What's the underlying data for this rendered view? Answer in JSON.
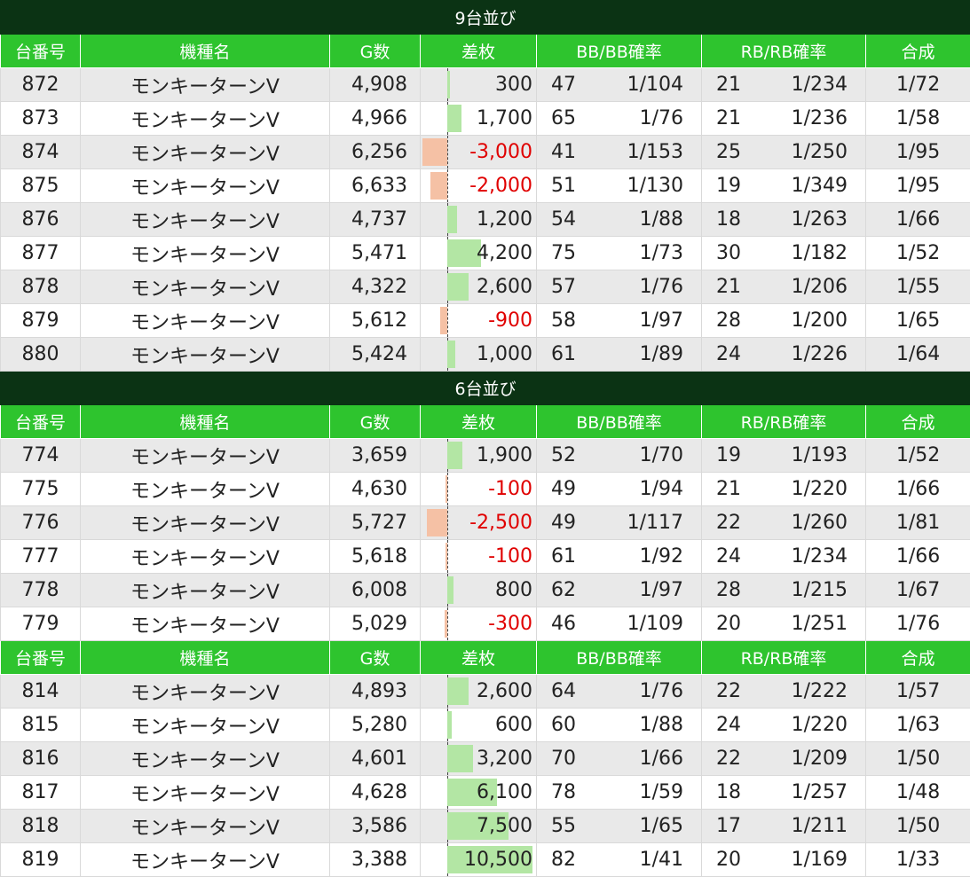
{
  "colors": {
    "title_bg": "#0b3314",
    "header_bg": "#2ec42e",
    "pos_bar": "#b3e6a4",
    "neg_bar": "#f5c1a5",
    "neg_text": "#e00000",
    "row_alt": "#e9e9e9"
  },
  "headers": [
    "台番号",
    "機種名",
    "G数",
    "差枚",
    "BB/BB確率",
    "RB/RB確率",
    "合成"
  ],
  "diff_max": 10500,
  "blocks": [
    {
      "title": "9台並び",
      "rows": [
        {
          "num": "872",
          "model": "モンキーターンV",
          "games": "4,908",
          "diff": 300,
          "diff_label": "300",
          "bb": "47",
          "bb_rate": "1/104",
          "rb": "21",
          "rb_rate": "1/234",
          "total": "1/72"
        },
        {
          "num": "873",
          "model": "モンキーターンV",
          "games": "4,966",
          "diff": 1700,
          "diff_label": "1,700",
          "bb": "65",
          "bb_rate": "1/76",
          "rb": "21",
          "rb_rate": "1/236",
          "total": "1/58"
        },
        {
          "num": "874",
          "model": "モンキーターンV",
          "games": "6,256",
          "diff": -3000,
          "diff_label": "-3,000",
          "bb": "41",
          "bb_rate": "1/153",
          "rb": "25",
          "rb_rate": "1/250",
          "total": "1/95"
        },
        {
          "num": "875",
          "model": "モンキーターンV",
          "games": "6,633",
          "diff": -2000,
          "diff_label": "-2,000",
          "bb": "51",
          "bb_rate": "1/130",
          "rb": "19",
          "rb_rate": "1/349",
          "total": "1/95"
        },
        {
          "num": "876",
          "model": "モンキーターンV",
          "games": "4,737",
          "diff": 1200,
          "diff_label": "1,200",
          "bb": "54",
          "bb_rate": "1/88",
          "rb": "18",
          "rb_rate": "1/263",
          "total": "1/66"
        },
        {
          "num": "877",
          "model": "モンキーターンV",
          "games": "5,471",
          "diff": 4200,
          "diff_label": "4,200",
          "bb": "75",
          "bb_rate": "1/73",
          "rb": "30",
          "rb_rate": "1/182",
          "total": "1/52"
        },
        {
          "num": "878",
          "model": "モンキーターンV",
          "games": "4,322",
          "diff": 2600,
          "diff_label": "2,600",
          "bb": "57",
          "bb_rate": "1/76",
          "rb": "21",
          "rb_rate": "1/206",
          "total": "1/55"
        },
        {
          "num": "879",
          "model": "モンキーターンV",
          "games": "5,612",
          "diff": -900,
          "diff_label": "-900",
          "bb": "58",
          "bb_rate": "1/97",
          "rb": "28",
          "rb_rate": "1/200",
          "total": "1/65"
        },
        {
          "num": "880",
          "model": "モンキーターンV",
          "games": "5,424",
          "diff": 1000,
          "diff_label": "1,000",
          "bb": "61",
          "bb_rate": "1/89",
          "rb": "24",
          "rb_rate": "1/226",
          "total": "1/64"
        }
      ]
    },
    {
      "title": "6台並び",
      "rows": [
        {
          "num": "774",
          "model": "モンキーターンV",
          "games": "3,659",
          "diff": 1900,
          "diff_label": "1,900",
          "bb": "52",
          "bb_rate": "1/70",
          "rb": "19",
          "rb_rate": "1/193",
          "total": "1/52"
        },
        {
          "num": "775",
          "model": "モンキーターンV",
          "games": "4,630",
          "diff": -100,
          "diff_label": "-100",
          "bb": "49",
          "bb_rate": "1/94",
          "rb": "21",
          "rb_rate": "1/220",
          "total": "1/66"
        },
        {
          "num": "776",
          "model": "モンキーターンV",
          "games": "5,727",
          "diff": -2500,
          "diff_label": "-2,500",
          "bb": "49",
          "bb_rate": "1/117",
          "rb": "22",
          "rb_rate": "1/260",
          "total": "1/81"
        },
        {
          "num": "777",
          "model": "モンキーターンV",
          "games": "5,618",
          "diff": -100,
          "diff_label": "-100",
          "bb": "61",
          "bb_rate": "1/92",
          "rb": "24",
          "rb_rate": "1/234",
          "total": "1/66"
        },
        {
          "num": "778",
          "model": "モンキーターンV",
          "games": "6,008",
          "diff": 800,
          "diff_label": "800",
          "bb": "62",
          "bb_rate": "1/97",
          "rb": "28",
          "rb_rate": "1/215",
          "total": "1/67"
        },
        {
          "num": "779",
          "model": "モンキーターンV",
          "games": "5,029",
          "diff": -300,
          "diff_label": "-300",
          "bb": "46",
          "bb_rate": "1/109",
          "rb": "20",
          "rb_rate": "1/251",
          "total": "1/76"
        }
      ]
    },
    {
      "title": "",
      "rows": [
        {
          "num": "814",
          "model": "モンキーターンV",
          "games": "4,893",
          "diff": 2600,
          "diff_label": "2,600",
          "bb": "64",
          "bb_rate": "1/76",
          "rb": "22",
          "rb_rate": "1/222",
          "total": "1/57"
        },
        {
          "num": "815",
          "model": "モンキーターンV",
          "games": "5,280",
          "diff": 600,
          "diff_label": "600",
          "bb": "60",
          "bb_rate": "1/88",
          "rb": "24",
          "rb_rate": "1/220",
          "total": "1/63"
        },
        {
          "num": "816",
          "model": "モンキーターンV",
          "games": "4,601",
          "diff": 3200,
          "diff_label": "3,200",
          "bb": "70",
          "bb_rate": "1/66",
          "rb": "22",
          "rb_rate": "1/209",
          "total": "1/50"
        },
        {
          "num": "817",
          "model": "モンキーターンV",
          "games": "4,628",
          "diff": 6100,
          "diff_label": "6,100",
          "bb": "78",
          "bb_rate": "1/59",
          "rb": "18",
          "rb_rate": "1/257",
          "total": "1/48"
        },
        {
          "num": "818",
          "model": "モンキーターンV",
          "games": "3,586",
          "diff": 7500,
          "diff_label": "7,500",
          "bb": "55",
          "bb_rate": "1/65",
          "rb": "17",
          "rb_rate": "1/211",
          "total": "1/50"
        },
        {
          "num": "819",
          "model": "モンキーターンV",
          "games": "3,388",
          "diff": 10500,
          "diff_label": "10,500",
          "bb": "82",
          "bb_rate": "1/41",
          "rb": "20",
          "rb_rate": "1/169",
          "total": "1/33"
        }
      ]
    }
  ]
}
